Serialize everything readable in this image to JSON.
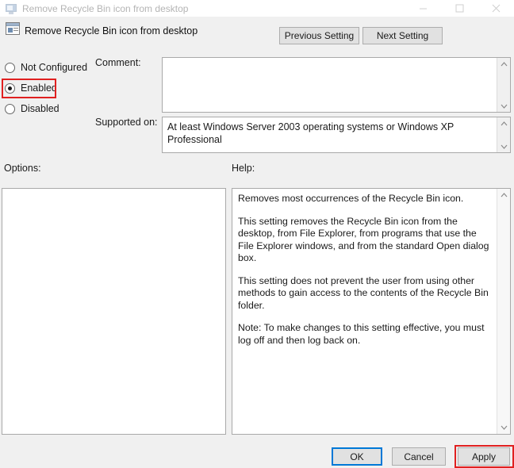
{
  "window": {
    "title": "Remove Recycle Bin icon from desktop",
    "icon": "policy-setting-icon",
    "controls": {
      "minimize": "minimize-icon",
      "maximize": "maximize-icon",
      "close": "close-icon"
    }
  },
  "header": {
    "icon": "policy-setting-icon",
    "title": "Remove Recycle Bin icon from desktop",
    "previous_label": "Previous Setting",
    "next_label": "Next Setting"
  },
  "state_options": {
    "items": [
      {
        "label": "Not Configured",
        "selected": false
      },
      {
        "label": "Enabled",
        "selected": true
      },
      {
        "label": "Disabled",
        "selected": false
      }
    ],
    "selected_value": "Enabled"
  },
  "comment": {
    "label": "Comment:",
    "value": "",
    "placeholder": ""
  },
  "supported_on": {
    "label": "Supported on:",
    "value": "At least Windows Server 2003 operating systems or Windows XP Professional"
  },
  "options": {
    "label": "Options:",
    "content": ""
  },
  "help": {
    "label": "Help:",
    "paragraphs": [
      "Removes most occurrences of the Recycle Bin icon.",
      "This setting removes the Recycle Bin icon from the desktop, from File Explorer, from programs that use the File Explorer windows, and from the standard Open dialog box.",
      "This setting does not prevent the user from using other methods to gain access to the contents of the Recycle Bin folder.",
      "Note: To make changes to this setting effective, you must log off and then log back on."
    ]
  },
  "footer": {
    "ok_label": "OK",
    "cancel_label": "Cancel",
    "apply_label": "Apply"
  },
  "annotations": {
    "highlight_color": "#e02020",
    "focus_color": "#0078d7",
    "targets": [
      "Enabled",
      "Apply"
    ]
  },
  "scrollbars": {
    "up_arrow": "chevron-up-icon",
    "down_arrow": "chevron-down-icon"
  }
}
